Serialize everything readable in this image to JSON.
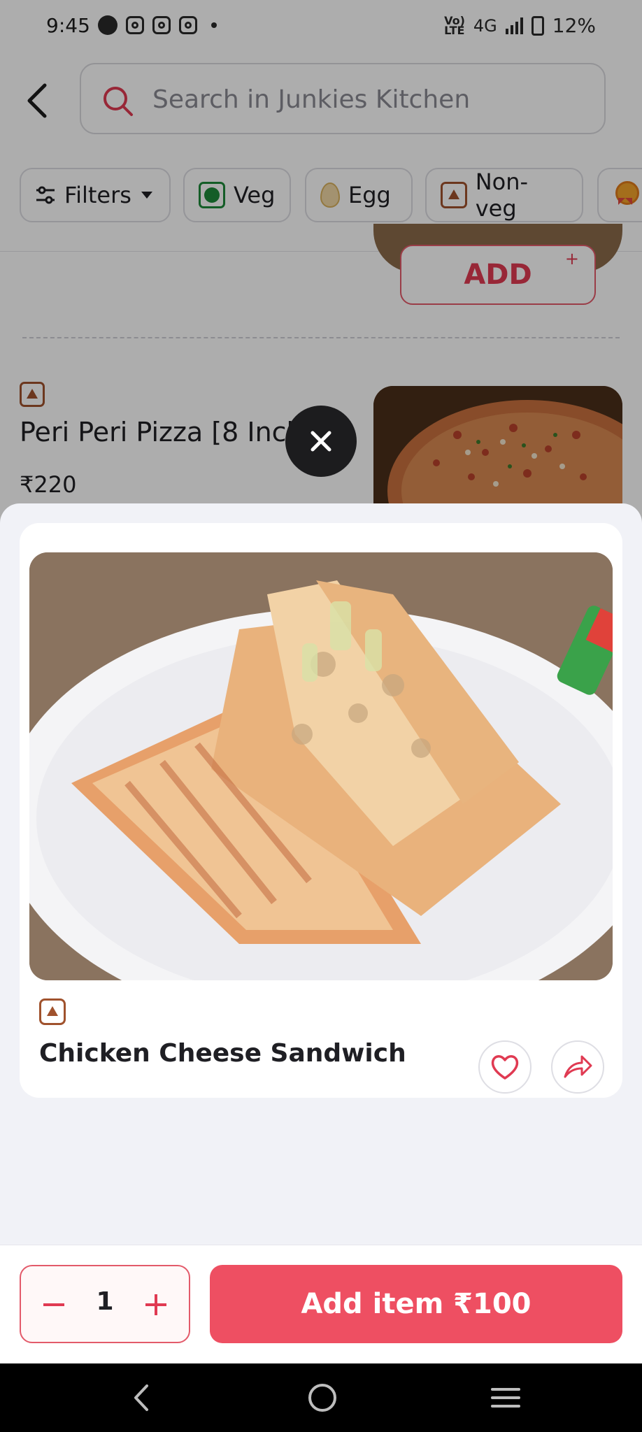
{
  "status_bar": {
    "time": "9:45",
    "network_small": "Vo)\nLTE",
    "network_type": "4G",
    "battery": "12%"
  },
  "search": {
    "placeholder": "Search in Junkies Kitchen"
  },
  "filters": {
    "filters_label": "Filters",
    "veg_label": "Veg",
    "egg_label": "Egg",
    "nonveg_label": "Non-veg"
  },
  "menu": {
    "add_label": "ADD",
    "add_plus": "+",
    "item_name": "Peri Peri Pizza [8 Inch",
    "item_price": "₹220"
  },
  "sheet": {
    "item_title": "Chicken Cheese Sandwich",
    "quantity": "1",
    "add_item_label": "Add item ₹100"
  },
  "icons": {
    "back": "chevron-left-icon",
    "search": "search-icon",
    "close": "close-icon",
    "favorite": "heart-icon",
    "share": "share-icon",
    "minus": "minus-icon",
    "plus": "plus-icon"
  },
  "colors": {
    "accent": "#ee4f62",
    "nonveg": "#a0522d",
    "veg": "#1e8a3a"
  }
}
